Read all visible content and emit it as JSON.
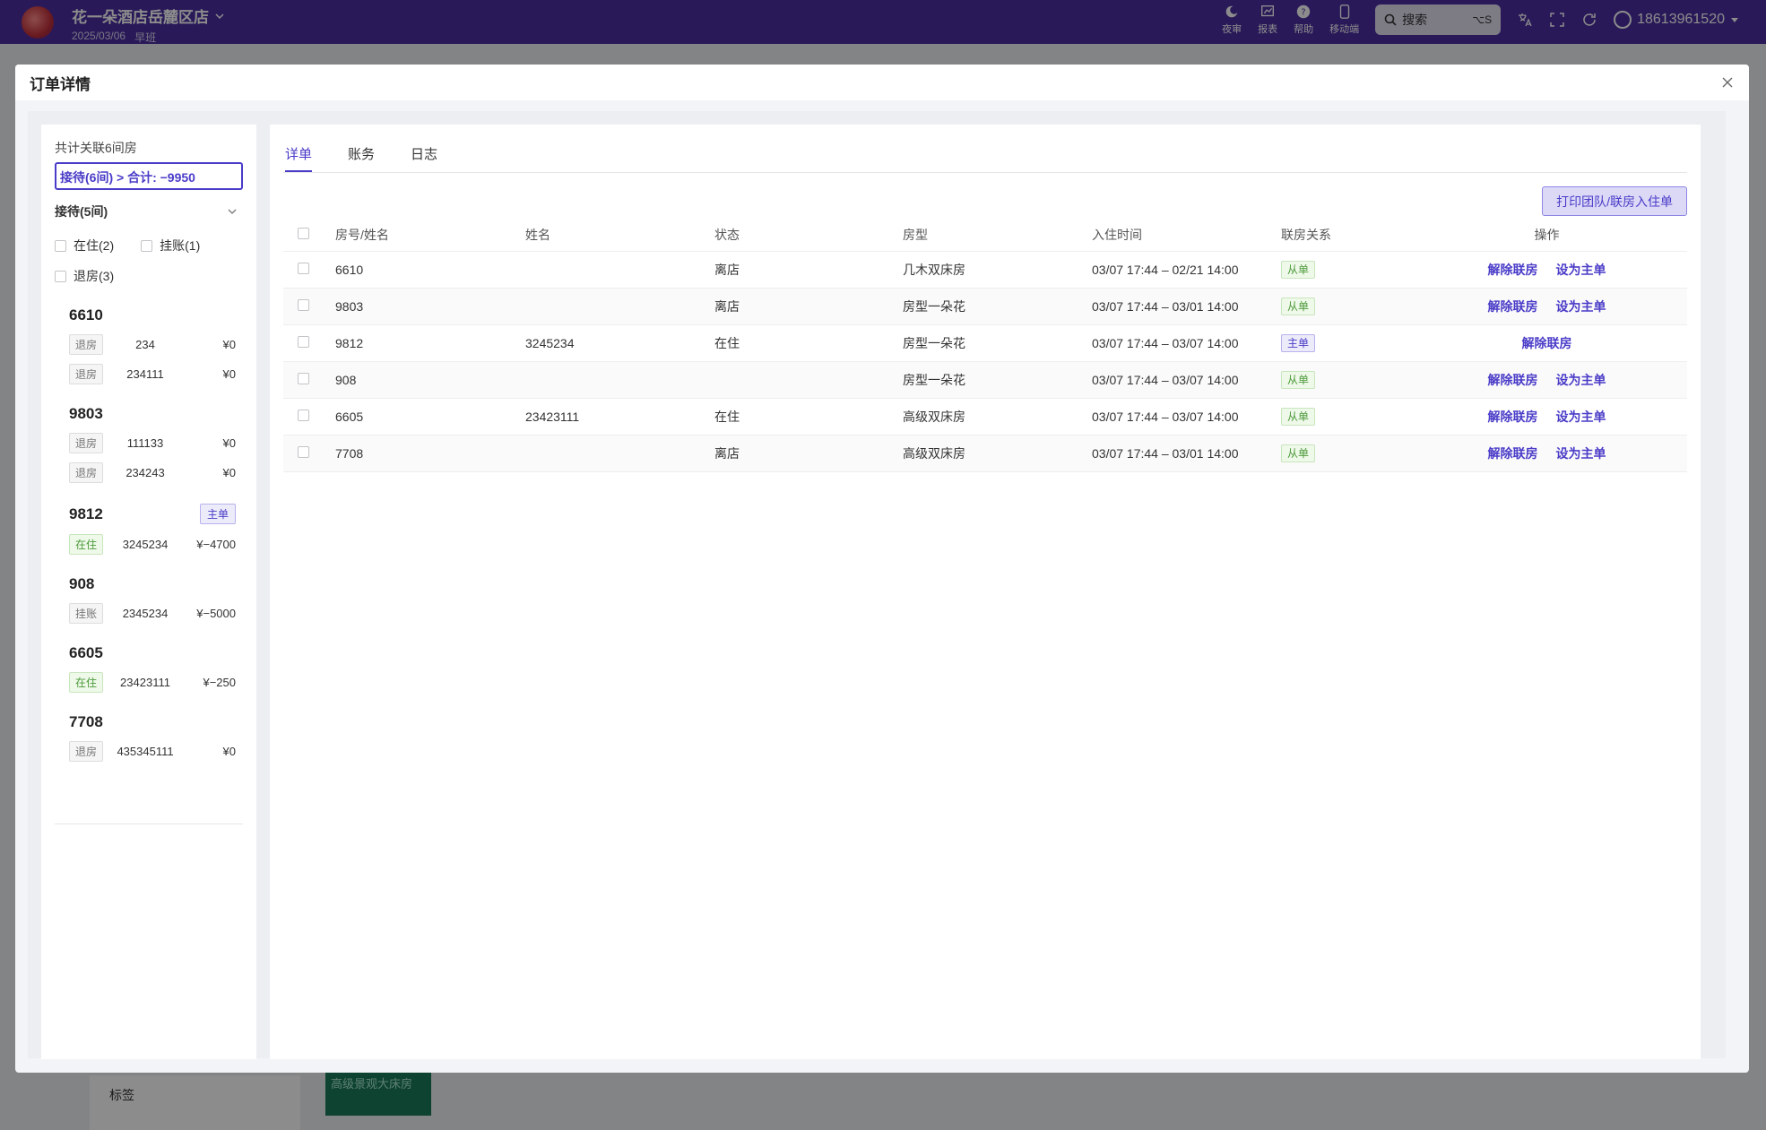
{
  "app": {
    "store_name": "花一朵酒店岳麓区店",
    "date": "2025/03/06",
    "shift": "早班",
    "tools": [
      {
        "icon": "moon-icon",
        "label": "夜审"
      },
      {
        "icon": "chart-icon",
        "label": "报表"
      },
      {
        "icon": "help-icon",
        "label": "帮助"
      },
      {
        "icon": "mobile-icon",
        "label": "移动端"
      }
    ],
    "search_placeholder": "搜索",
    "search_shortcut": "⌥S",
    "user_phone": "18613961520",
    "bg_tag_label": "标签",
    "bg_room_label": "高级景观大床房"
  },
  "modal": {
    "title": "订单详情"
  },
  "left": {
    "count_text": "共计关联6间房",
    "summary_text": "接待(6间) > 合计: −9950",
    "group_label": "接待(5间)",
    "filters": [
      {
        "label": "在住(2)"
      },
      {
        "label": "挂账(1)"
      },
      {
        "label": "退房(3)"
      }
    ],
    "rooms": [
      {
        "room": "6610",
        "is_main": false,
        "guests": [
          {
            "status": "退房",
            "status_type": "out",
            "name": "234",
            "amount": "¥0"
          },
          {
            "status": "退房",
            "status_type": "out",
            "name": "234111",
            "amount": "¥0"
          }
        ]
      },
      {
        "room": "9803",
        "is_main": false,
        "guests": [
          {
            "status": "退房",
            "status_type": "out",
            "name": "111133",
            "amount": "¥0"
          },
          {
            "status": "退房",
            "status_type": "out",
            "name": "234243",
            "amount": "¥0"
          }
        ]
      },
      {
        "room": "9812",
        "is_main": true,
        "main_label": "主单",
        "guests": [
          {
            "status": "在住",
            "status_type": "in",
            "name": "3245234",
            "amount": "¥−4700"
          }
        ]
      },
      {
        "room": "908",
        "is_main": false,
        "guests": [
          {
            "status": "挂账",
            "status_type": "out",
            "name": "2345234",
            "amount": "¥−5000"
          }
        ]
      },
      {
        "room": "6605",
        "is_main": false,
        "guests": [
          {
            "status": "在住",
            "status_type": "in",
            "name": "23423111",
            "amount": "¥−250"
          }
        ]
      },
      {
        "room": "7708",
        "is_main": false,
        "guests": [
          {
            "status": "退房",
            "status_type": "out",
            "name": "435345111",
            "amount": "¥0"
          }
        ]
      }
    ]
  },
  "right": {
    "tabs": [
      {
        "label": "详单",
        "active": true
      },
      {
        "label": "账务",
        "active": false
      },
      {
        "label": "日志",
        "active": false
      }
    ],
    "print_button": "打印团队/联房入住单",
    "columns": [
      "房号/姓名",
      "姓名",
      "状态",
      "房型",
      "入住时间",
      "联房关系",
      "操作"
    ],
    "rows": [
      {
        "room": "6610",
        "name": "",
        "status": "离店",
        "type": "几木双床房",
        "time": "03/07 17:44 – 02/21 14:00",
        "relation": "从单",
        "is_main": false
      },
      {
        "room": "9803",
        "name": "",
        "status": "离店",
        "type": "房型一朵花",
        "time": "03/07 17:44 – 03/01 14:00",
        "relation": "从单",
        "is_main": false
      },
      {
        "room": "9812",
        "name": "3245234",
        "status": "在住",
        "type": "房型一朵花",
        "time": "03/07 17:44 – 03/07 14:00",
        "relation": "主单",
        "is_main": true
      },
      {
        "room": "908",
        "name": "",
        "status": "",
        "type": "房型一朵花",
        "time": "03/07 17:44 – 03/07 14:00",
        "relation": "从单",
        "is_main": false
      },
      {
        "room": "6605",
        "name": "23423111",
        "status": "在住",
        "type": "高级双床房",
        "time": "03/07 17:44 – 03/07 14:00",
        "relation": "从单",
        "is_main": false
      },
      {
        "room": "7708",
        "name": "",
        "status": "离店",
        "type": "高级双床房",
        "time": "03/07 17:44 – 03/01 14:00",
        "relation": "从单",
        "is_main": false
      }
    ],
    "op_unlink": "解除联房",
    "op_set_main": "设为主单"
  },
  "colors": {
    "accent": "#4a3cc8",
    "topbar": "#4c2fa3",
    "success": "#4c9a3a"
  }
}
